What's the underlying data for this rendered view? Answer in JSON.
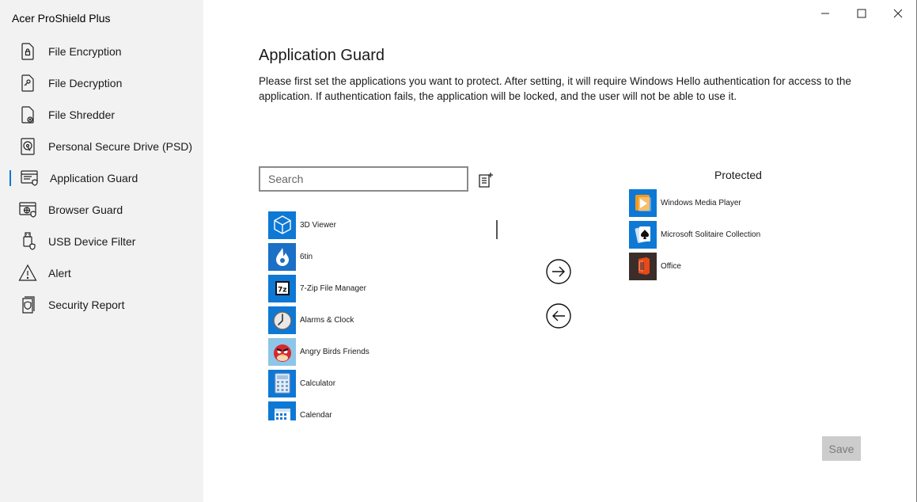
{
  "app": {
    "title": "Acer ProShield Plus"
  },
  "sidebar": {
    "items": [
      {
        "label": "File Encryption",
        "icon": "file-lock-icon"
      },
      {
        "label": "File Decryption",
        "icon": "file-key-icon"
      },
      {
        "label": "File Shredder",
        "icon": "file-shred-icon"
      },
      {
        "label": "Personal Secure Drive (PSD)",
        "icon": "secure-drive-icon"
      },
      {
        "label": "Application Guard",
        "icon": "app-guard-icon",
        "active": true
      },
      {
        "label": "Browser Guard",
        "icon": "browser-guard-icon"
      },
      {
        "label": "USB Device Filter",
        "icon": "usb-icon"
      },
      {
        "label": "Alert",
        "icon": "alert-icon"
      },
      {
        "label": "Security Report",
        "icon": "security-report-icon"
      }
    ]
  },
  "main": {
    "title": "Application Guard",
    "description": "Please first set the applications you want to protect. After setting, it will require Windows Hello authentication for access to the application. If authentication fails, the application will be locked, and the user will not be able to use it.",
    "search": {
      "placeholder": "Search",
      "value": ""
    },
    "apps": [
      {
        "name": "3D Viewer",
        "icon": "3d-viewer-icon"
      },
      {
        "name": "6tin",
        "icon": "6tin-icon"
      },
      {
        "name": "7-Zip File Manager",
        "icon": "7zip-icon"
      },
      {
        "name": "Alarms & Clock",
        "icon": "alarm-clock-icon"
      },
      {
        "name": "Angry Birds Friends",
        "icon": "angry-birds-icon"
      },
      {
        "name": "Calculator",
        "icon": "calculator-icon"
      },
      {
        "name": "Calendar",
        "icon": "calendar-icon"
      }
    ],
    "protected_title": "Protected",
    "protected": [
      {
        "name": "Windows Media Player",
        "icon": "media-player-icon"
      },
      {
        "name": "Microsoft Solitaire Collection",
        "icon": "solitaire-icon"
      },
      {
        "name": "Office",
        "icon": "office-icon"
      }
    ],
    "save_label": "Save"
  },
  "colors": {
    "accent": "#0078d4",
    "sidebar_bg": "#f2f2f2",
    "save_disabled_bg": "#cccccc"
  }
}
